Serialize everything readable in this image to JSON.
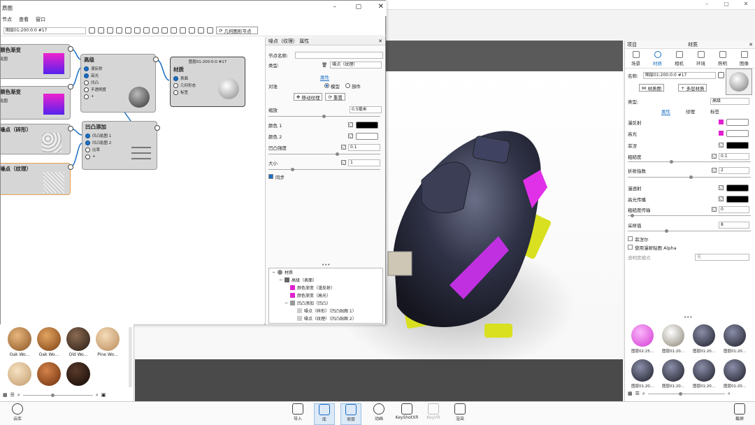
{
  "graph_window": {
    "title": "质图",
    "menu": [
      "节点",
      "查看",
      "窗口"
    ],
    "selector": "图层01:200:0:0 #17",
    "toolbar_button": "几何图形节点",
    "nodes": {
      "grad1": {
        "title": "颜色渐变",
        "sub": "贴图",
        "color": "#cc22ee"
      },
      "grad2": {
        "title": "颜色渐变",
        "sub": "贴图",
        "color": "#cc22ee"
      },
      "noise1": {
        "title": "噪点（碎形）",
        "sub": ""
      },
      "noise2": {
        "title": "噪点（纹理）",
        "sub": ""
      },
      "advanced": {
        "title": "高级",
        "ports": [
          "漫反射",
          "高光",
          "凹凸",
          "不透明度",
          "+"
        ]
      },
      "bump_add": {
        "title": "凹凸添加",
        "ports": [
          "凹凸贴图 1",
          "凹凸贴图 2",
          "比率",
          "+"
        ]
      },
      "output": {
        "header": "图层01:200:0:0 #17",
        "title": "材质",
        "ports": [
          "表面",
          "几何形态",
          "标签"
        ]
      }
    },
    "props": {
      "title": "噪点（纹理） 属性",
      "node_name_label": "节点名称:",
      "type_label": "类型:",
      "type_value": "噪点（纹理）",
      "section": "属性",
      "align_label": "对准",
      "radio_model": "模型",
      "radio_part": "部件",
      "move_texture": "移动纹理",
      "reset": "重置",
      "scale_label": "缩放",
      "scale_value": "0.5毫米",
      "color1_label": "颜色 1",
      "color2_label": "颜色 2",
      "bump_label": "凹凸强度",
      "bump_value": "0.1",
      "size_label": "大小",
      "size_value": "1",
      "sync_label": "同步",
      "tree": [
        "材质",
        "高级（表面）",
        "颜色渐变（漫反射）",
        "颜色渐变（高光）",
        "凹凸添加（凹凸）",
        "噪点（碎形）（凹凸贴图 1）",
        "噪点（纹理）（凹凸贴图 2）"
      ]
    }
  },
  "right_panel": {
    "header_left": "项目",
    "header_title": "材质",
    "tabs": [
      "场景",
      "材质",
      "相机",
      "环境",
      "照明",
      "图像"
    ],
    "name_label": "名称:",
    "name_value": "图层01:200:0:0 #17",
    "material_graph_btn": "材质图",
    "multi_layer_btn": "多层材质",
    "type_label": "类型:",
    "type_value": "高级",
    "subtabs": [
      "属性",
      "纹理",
      "标签"
    ],
    "props": [
      {
        "label": "漫反射",
        "color": "#ffffff",
        "kind": "swatch"
      },
      {
        "label": "高光",
        "color": "#ffffff",
        "kind": "swatch"
      },
      {
        "label": "菲涅",
        "color": "#000000",
        "kind": "swatch"
      },
      {
        "label": "粗糙度",
        "value": "0.1",
        "kind": "field"
      },
      {
        "label": "折射指数",
        "value": "2",
        "kind": "field"
      },
      {
        "label": "漫透射",
        "color": "#000000",
        "kind": "swatch"
      },
      {
        "label": "高光传播",
        "color": "#000000",
        "kind": "swatch"
      },
      {
        "label": "粗糙度传输",
        "value": "0",
        "kind": "field"
      },
      {
        "label": "采样值",
        "value": "8",
        "kind": "field"
      }
    ],
    "checkbox_1": "菲涅尔",
    "checkbox_2": "使用漫射贴图 Alpha",
    "transparency_label": "透明度模式",
    "transparency_value": "无",
    "library": [
      "图层02:25...",
      "图层01:20...",
      "图层01:20...",
      "图层01:20...",
      "图层01:20...",
      "图层01:20...",
      "图层01:20...",
      "图层01:20..."
    ]
  },
  "left_library": [
    "Oak Wo...",
    "Oak Wo...",
    "Old Wo...",
    "Pine Wo...",
    "",
    "",
    "",
    ""
  ],
  "bottom_bar": {
    "cloud": "云库",
    "items": [
      "导入",
      "库",
      "项目",
      "动画",
      "KeyShotXR",
      "KeyVR",
      "渲染"
    ],
    "screenshot": "截屏"
  }
}
